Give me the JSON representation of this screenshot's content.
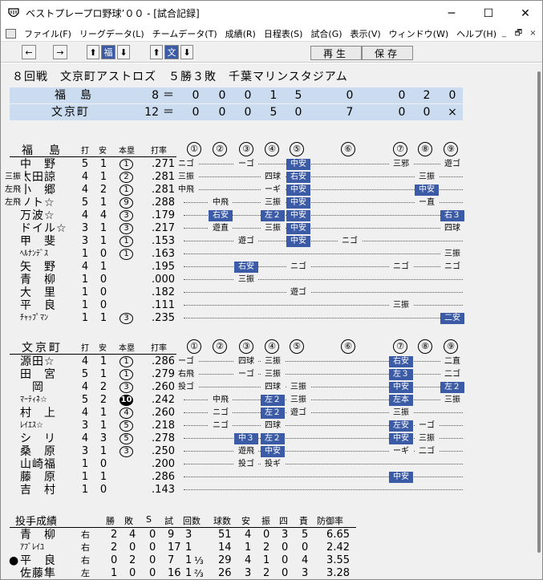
{
  "window": {
    "title": "ベストプレープロ野球’００ - [試合記録]",
    "minimize": "─",
    "maximize": "☐",
    "close": "✕"
  },
  "menu": {
    "items": [
      "ファイル(F)",
      "リーグデータ(L)",
      "チームデータ(T)",
      "成績(R)",
      "日程表(S)",
      "試合(G)",
      "表示(V)",
      "ウィンドウ(W)",
      "ヘルプ(H)"
    ],
    "mdi": [
      "_",
      "🗗",
      "×"
    ]
  },
  "toolbar": {
    "prev": "←",
    "next": "→",
    "team1_up": "⬆",
    "team1_label": "福",
    "team1_down": "⬇",
    "team2_up": "⬆",
    "team2_label": "文",
    "team2_down": "⬇",
    "play": "再生",
    "save": "保存"
  },
  "game": {
    "summary": "８回戦　文京町アストロズ　５勝３敗　千葉マリンスタジアム"
  },
  "scoreboard": [
    {
      "team": "福　島",
      "runs": "8",
      "innings": [
        "0",
        "0",
        "0",
        "1",
        "5",
        "0",
        "0",
        "2",
        "0"
      ]
    },
    {
      "team": "文京町",
      "runs": "12",
      "innings": [
        "0",
        "0",
        "0",
        "5",
        "0",
        "7",
        "0",
        "0",
        "×"
      ]
    }
  ],
  "eq": "＝",
  "headers": {
    "bat": "打",
    "hit": "安",
    "hr": "本塁",
    "avg": "打率"
  },
  "inning_marks": [
    "①",
    "②",
    "③",
    "④",
    "⑤",
    "⑥",
    "⑦",
    "⑧",
    "⑨"
  ],
  "team1": {
    "name": "福　島",
    "players": [
      {
        "name": "中　野",
        "ab": "5",
        "h": "1",
        "hr": "1",
        "avg": ".271",
        "abs": [
          [
            "ニゴ",
            0,
            0
          ],
          [
            "ーゴ",
            2,
            0
          ],
          [
            "中安",
            4,
            1
          ],
          [
            "三邪",
            6,
            0
          ],
          [
            "遊ゴ",
            8,
            0
          ]
        ]
      },
      {
        "name": "太田諒",
        "ab": "4",
        "h": "1",
        "hr": "2",
        "avg": ".281",
        "abs": [
          [
            "三振",
            0,
            0
          ],
          [
            "四球",
            3,
            0
          ],
          [
            "右安",
            4,
            1
          ],
          [
            "三振",
            7,
            0
          ],
          [
            "三振",
            9,
            0
          ]
        ]
      },
      {
        "name": "小　郷",
        "ab": "4",
        "h": "2",
        "hr": "1",
        "avg": ".281",
        "abs": [
          [
            "中飛",
            0,
            0
          ],
          [
            "ーギ",
            3,
            0
          ],
          [
            "中安",
            4,
            1
          ],
          [
            "中安",
            7,
            1
          ],
          [
            "左飛",
            9,
            0
          ]
        ]
      },
      {
        "name": "ソト☆",
        "ab": "5",
        "h": "1",
        "hr": "9",
        "avg": ".288",
        "abs": [
          [
            "中飛",
            1,
            0
          ],
          [
            "三振",
            3,
            0
          ],
          [
            "中安",
            4,
            1
          ],
          [
            "ー直",
            7,
            0
          ],
          [
            "左飛",
            9,
            0
          ]
        ]
      },
      {
        "name": "万波☆",
        "ab": "4",
        "h": "4",
        "hr": "3",
        "avg": ".179",
        "abs": [
          [
            "右安",
            1,
            1
          ],
          [
            "左２",
            3,
            1
          ],
          [
            "中安",
            4,
            1
          ],
          [
            "右３",
            8,
            1
          ]
        ]
      },
      {
        "name": "ドイル☆",
        "ab": "3",
        "h": "1",
        "hr": "3",
        "avg": ".217",
        "abs": [
          [
            "遊直",
            1,
            0
          ],
          [
            "三振",
            3,
            0
          ],
          [
            "中安",
            4,
            1
          ],
          [
            "四球",
            8,
            0
          ]
        ]
      },
      {
        "name": "甲　斐",
        "ab": "3",
        "h": "1",
        "hr": "1",
        "avg": ".153",
        "abs": [
          [
            "遊ゴ",
            2,
            0
          ],
          [
            "中安",
            4,
            1
          ],
          [
            "ニゴ",
            5,
            0
          ]
        ]
      },
      {
        "name": "ﾍﾙﾅﾝﾃﾞｽ",
        "small": true,
        "ab": "1",
        "h": "0",
        "hr": "1",
        "avg": ".163",
        "abs": [
          [
            "三振",
            8,
            0
          ]
        ]
      },
      {
        "name": "矢　野",
        "ab": "4",
        "h": "1",
        "hr": "",
        "avg": ".195",
        "abs": [
          [
            "右安",
            2,
            1
          ],
          [
            "ニゴ",
            4,
            0
          ],
          [
            "ニゴ",
            6,
            0
          ],
          [
            "ニゴ",
            8,
            0
          ]
        ]
      },
      {
        "name": "青　柳",
        "ab": "1",
        "h": "0",
        "hr": "",
        "avg": ".000",
        "abs": [
          [
            "三振",
            2,
            0
          ]
        ]
      },
      {
        "name": "大　里",
        "ab": "1",
        "h": "0",
        "hr": "",
        "avg": ".182",
        "abs": [
          [
            "遊ゴ",
            4,
            0
          ]
        ]
      },
      {
        "name": "平　良",
        "ab": "1",
        "h": "0",
        "hr": "",
        "avg": ".111",
        "abs": [
          [
            "三振",
            6,
            0
          ]
        ]
      },
      {
        "name": "ﾁｬｯﾌﾟﾏﾝ",
        "small": true,
        "ab": "1",
        "h": "1",
        "hr": "3",
        "avg": ".235",
        "abs": [
          [
            "二安",
            8,
            1
          ]
        ]
      }
    ]
  },
  "team2": {
    "name": "文京町",
    "players": [
      {
        "name": "源田☆",
        "ab": "4",
        "h": "1",
        "hr": "1",
        "avg": ".286",
        "abs": [
          [
            "ーゴ",
            0,
            0
          ],
          [
            "四球",
            2,
            0
          ],
          [
            "三振",
            3,
            0
          ],
          [
            "右安",
            6,
            1
          ],
          [
            "二直",
            8,
            0
          ]
        ]
      },
      {
        "name": "田　宮",
        "ab": "5",
        "h": "1",
        "hr": "1",
        "avg": ".279",
        "abs": [
          [
            "右飛",
            0,
            0
          ],
          [
            "ーゴ",
            2,
            0
          ],
          [
            "三振",
            3,
            0
          ],
          [
            "左３",
            6,
            1
          ],
          [
            "二ゴ",
            8,
            0
          ]
        ]
      },
      {
        "name": "　岡",
        "ab": "4",
        "h": "2",
        "hr": "3",
        "avg": ".260",
        "abs": [
          [
            "投ゴ",
            0,
            0
          ],
          [
            "四球",
            3,
            0
          ],
          [
            "三振",
            4,
            0
          ],
          [
            "中安",
            6,
            1
          ],
          [
            "左２",
            8,
            1
          ]
        ]
      },
      {
        "name": "ﾏｰﾃｨﾈ☆",
        "small": true,
        "ab": "5",
        "h": "2",
        "hr": "10",
        "avg": ".242",
        "abs": [
          [
            "中飛",
            1,
            0
          ],
          [
            "左２",
            3,
            1
          ],
          [
            "三振",
            4,
            0
          ],
          [
            "左本",
            6,
            1
          ],
          [
            "三振",
            8,
            0
          ]
        ]
      },
      {
        "name": "村　上",
        "ab": "4",
        "h": "1",
        "hr": "4",
        "avg": ".260",
        "abs": [
          [
            "ニゴ",
            1,
            0
          ],
          [
            "左２",
            3,
            1
          ],
          [
            "遊ゴ",
            4,
            0
          ],
          [
            "三振",
            6,
            0
          ]
        ]
      },
      {
        "name": "ﾚｲｴｽ☆",
        "small": true,
        "ab": "3",
        "h": "1",
        "hr": "5",
        "avg": ".218",
        "abs": [
          [
            "ニゴ",
            1,
            0
          ],
          [
            "四球",
            3,
            0
          ],
          [
            "左安",
            6,
            1
          ],
          [
            "ーゴ",
            7,
            0
          ]
        ]
      },
      {
        "name": "シ　リ",
        "ab": "4",
        "h": "3",
        "hr": "5",
        "avg": ".278",
        "abs": [
          [
            "中３",
            2,
            1
          ],
          [
            "左２",
            3,
            1
          ],
          [
            "中安",
            6,
            1
          ],
          [
            "三振",
            7,
            0
          ]
        ]
      },
      {
        "name": "桑　原",
        "ab": "3",
        "h": "1",
        "hr": "3",
        "avg": ".250",
        "abs": [
          [
            "遊飛",
            2,
            0
          ],
          [
            "中安",
            3,
            1
          ],
          [
            "ーギ",
            6,
            0
          ],
          [
            "二ゴ",
            7,
            0
          ]
        ]
      },
      {
        "name": "山崎福",
        "ab": "1",
        "h": "0",
        "hr": "",
        "avg": ".200",
        "abs": [
          [
            "投ゴ",
            2,
            0
          ],
          [
            "投ギ",
            3,
            0
          ]
        ]
      },
      {
        "name": "藤　原",
        "ab": "1",
        "h": "1",
        "hr": "",
        "avg": ".286",
        "abs": [
          [
            "中安",
            6,
            1
          ]
        ]
      },
      {
        "name": "吉　村",
        "ab": "1",
        "h": "0",
        "hr": "",
        "avg": ".143",
        "abs": []
      }
    ]
  },
  "pitching": {
    "title": "投手成績",
    "headers": [
      "勝",
      "敗",
      "S",
      "試",
      "回数",
      "球数",
      "安",
      "振",
      "四",
      "責",
      "防御率"
    ],
    "rows": [
      {
        "mark": "",
        "name": "青　柳",
        "hand": "右",
        "w": "2",
        "l": "4",
        "s": "0",
        "g": "9",
        "ip": "3",
        "ipf": "",
        "np": "51",
        "h": "4",
        "k": "0",
        "bb": "3",
        "er": "5",
        "era": "6.65"
      },
      {
        "mark": "",
        "name": "ｱﾌﾞﾚｲﾕ",
        "small": true,
        "hand": "右",
        "w": "2",
        "l": "0",
        "s": "0",
        "g": "17",
        "ip": "1",
        "ipf": "",
        "np": "14",
        "h": "1",
        "k": "2",
        "bb": "0",
        "er": "0",
        "era": "2.42"
      },
      {
        "mark": "●",
        "name": "平　良",
        "hand": "右",
        "w": "0",
        "l": "2",
        "s": "0",
        "g": "7",
        "ip": "1",
        "ipf": "⅓",
        "np": "29",
        "h": "4",
        "k": "1",
        "bb": "0",
        "er": "4",
        "era": "3.55"
      },
      {
        "mark": "",
        "name": "佐藤隼",
        "hand": "左",
        "w": "1",
        "l": "0",
        "s": "0",
        "g": "16",
        "ip": "1",
        "ipf": "⅔",
        "np": "26",
        "h": "3",
        "k": "2",
        "bb": "0",
        "er": "3",
        "era": "3.28"
      }
    ]
  },
  "colors": {
    "hit_bg": "#3b5ba7",
    "scoreboard_bg": "#ccdcf0",
    "panel_bg": "#f0f0f0"
  }
}
